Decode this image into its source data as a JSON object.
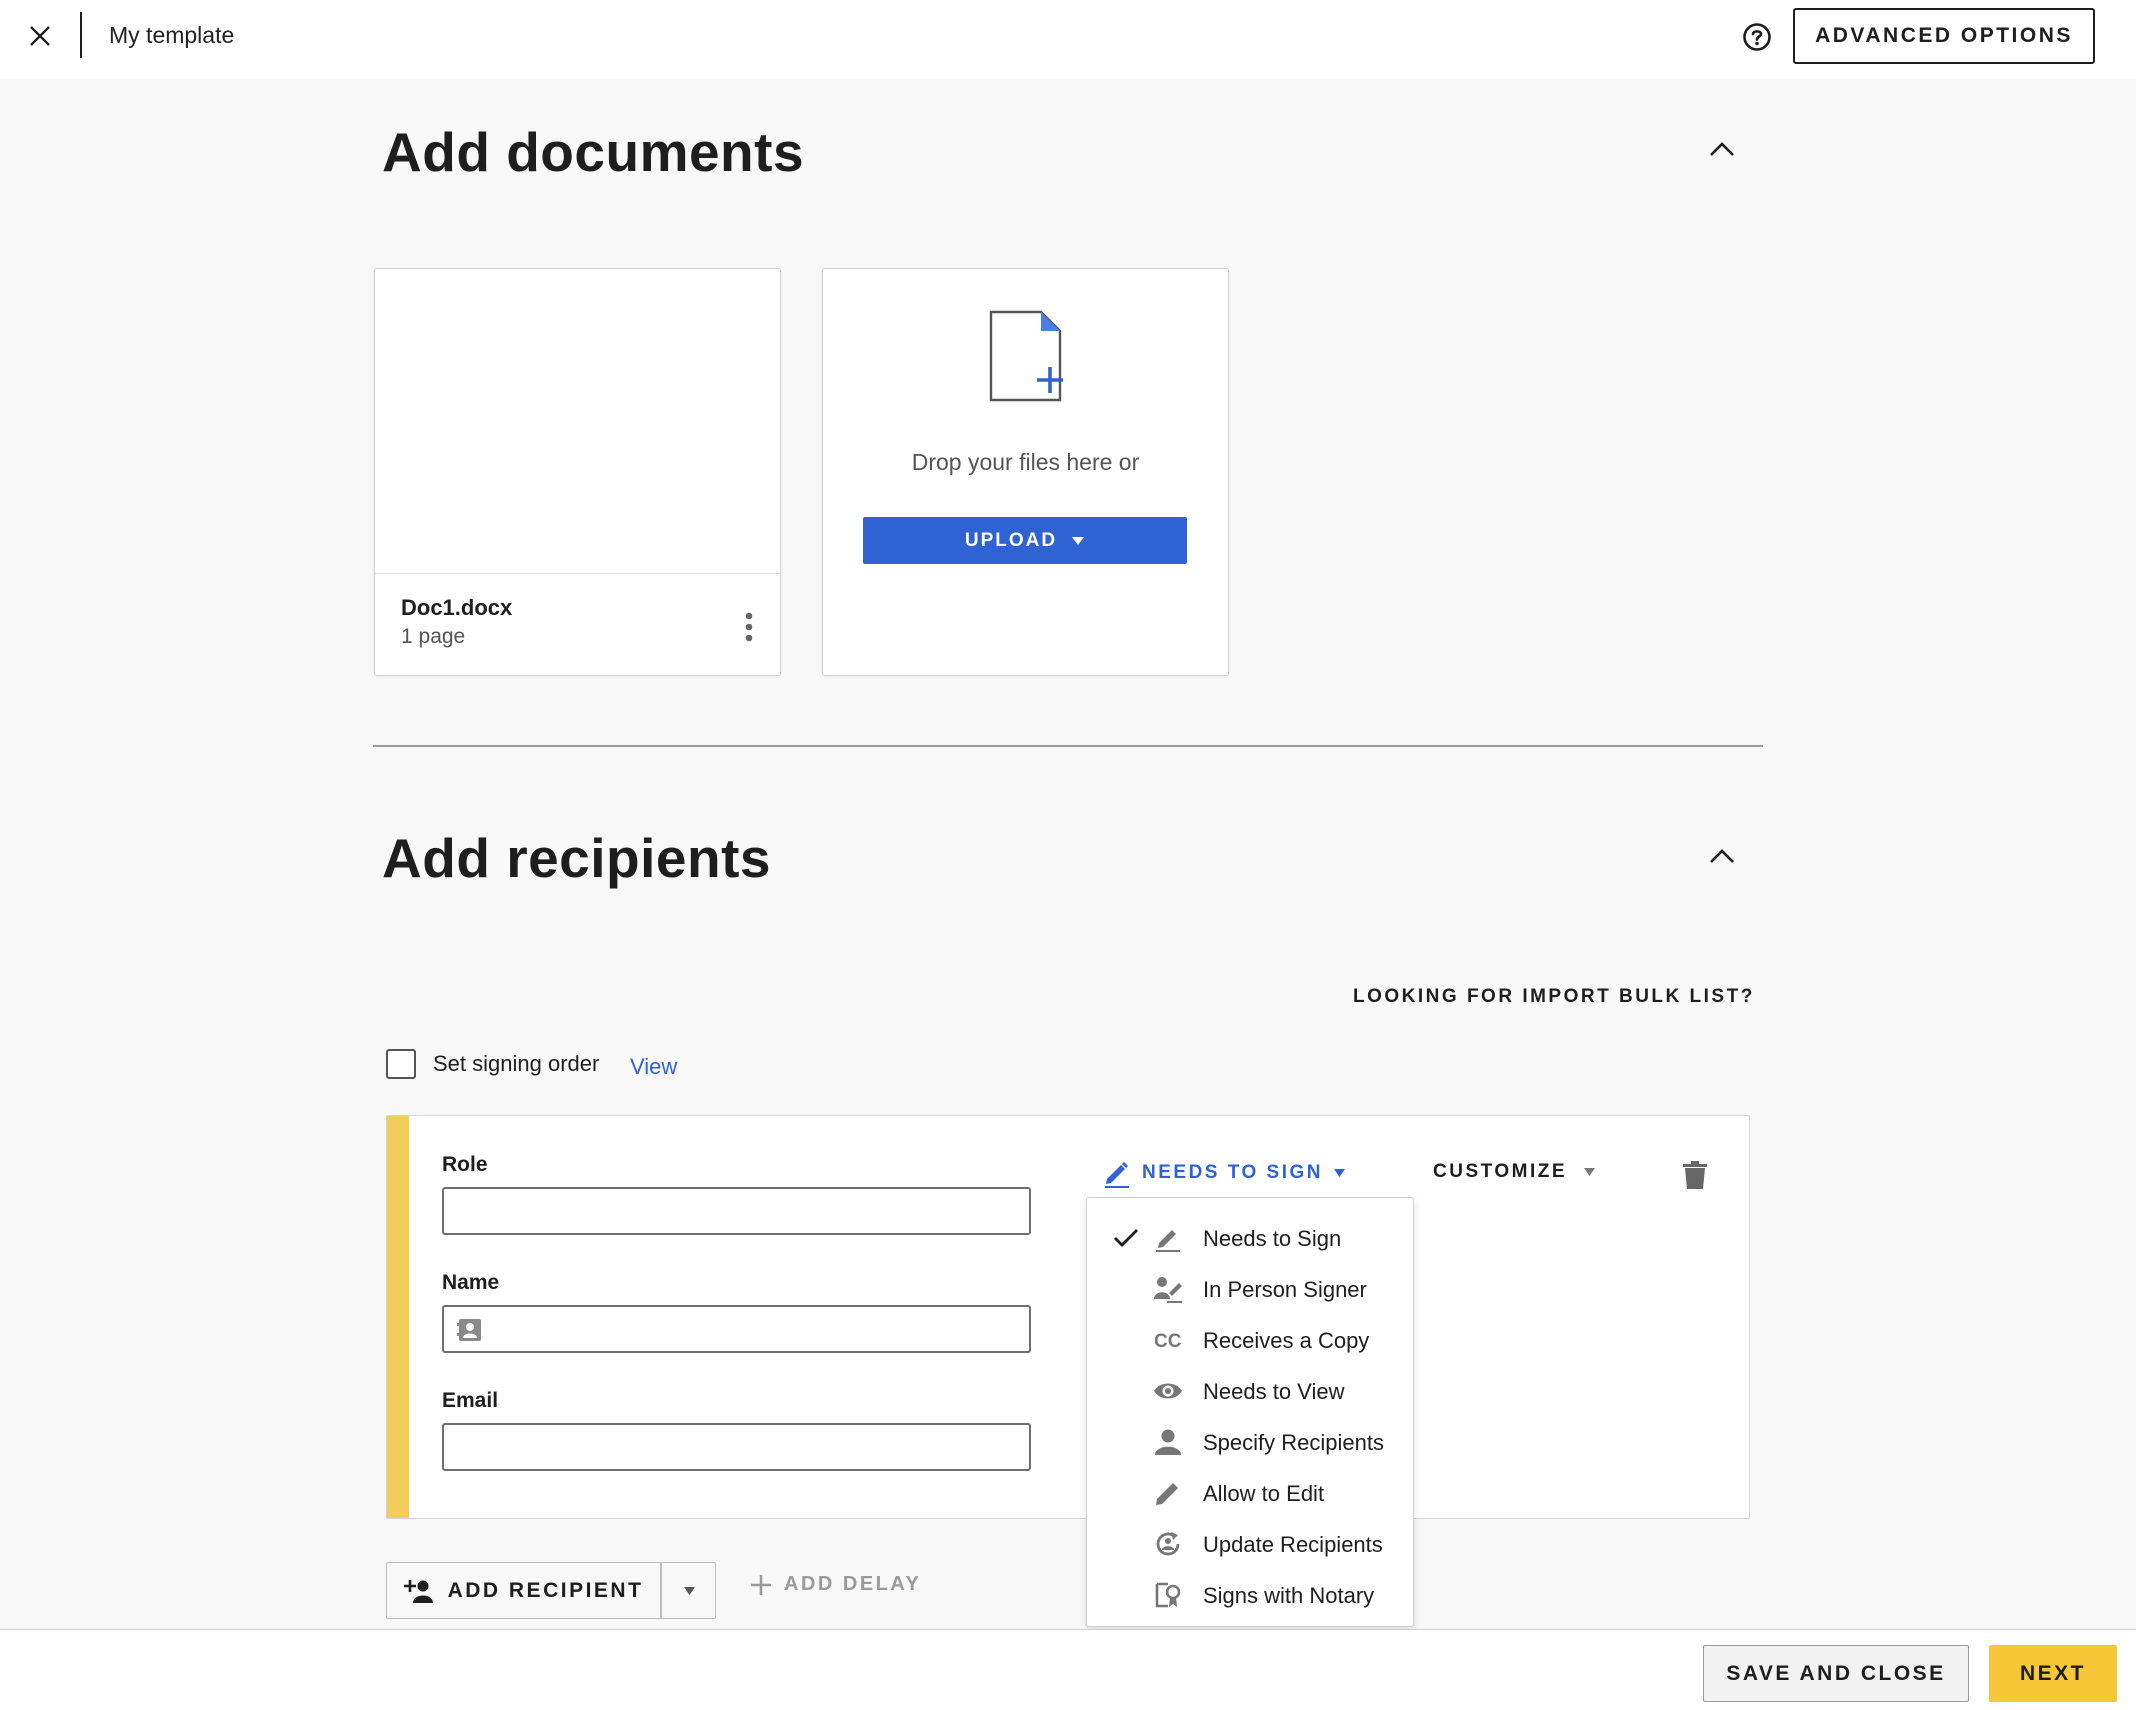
{
  "header": {
    "template_name": "My template",
    "advanced_options_label": "ADVANCED OPTIONS"
  },
  "documents": {
    "title": "Add documents",
    "items": [
      {
        "name": "Doc1.docx",
        "pages": "1 page"
      }
    ],
    "upload": {
      "drop_text": "Drop your files here or",
      "button_label": "UPLOAD"
    }
  },
  "recipients": {
    "title": "Add recipients",
    "bulk_list_link": "LOOKING FOR IMPORT BULK LIST?",
    "signing_order": {
      "label": "Set signing order",
      "checked": false,
      "view_link": "View"
    },
    "recipient": {
      "accent_color": "#f3cd5a",
      "fields": {
        "role_label": "Role",
        "role_value": "",
        "name_label": "Name",
        "name_value": "",
        "email_label": "Email",
        "email_value": ""
      },
      "action_label": "NEEDS TO SIGN",
      "customize_label": "CUSTOMIZE"
    },
    "action_menu": [
      {
        "label": "Needs to Sign",
        "icon": "pen-icon",
        "selected": true
      },
      {
        "label": "In Person Signer",
        "icon": "in-person-signer-icon",
        "selected": false
      },
      {
        "label": "Receives a Copy",
        "icon": "cc-icon",
        "selected": false
      },
      {
        "label": "Needs to View",
        "icon": "eye-icon",
        "selected": false
      },
      {
        "label": "Specify Recipients",
        "icon": "person-icon",
        "selected": false
      },
      {
        "label": "Allow to Edit",
        "icon": "pencil-icon",
        "selected": false
      },
      {
        "label": "Update Recipients",
        "icon": "update-recipients-icon",
        "selected": false
      },
      {
        "label": "Signs with Notary",
        "icon": "notary-icon",
        "selected": false
      }
    ],
    "add_recipient_label": "ADD RECIPIENT",
    "add_delay_label": "ADD DELAY"
  },
  "footer": {
    "save_close_label": "SAVE AND CLOSE",
    "next_label": "NEXT"
  },
  "colors": {
    "accent_blue": "#2f62d2",
    "next_yellow": "#f6c736"
  }
}
